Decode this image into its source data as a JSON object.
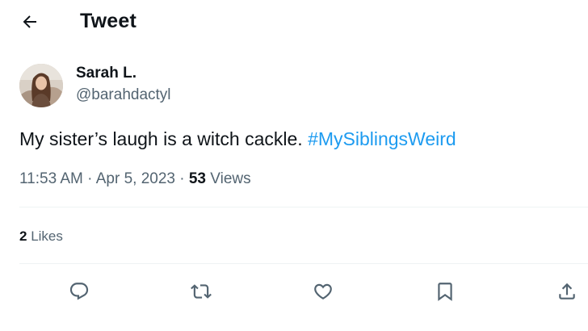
{
  "header": {
    "title": "Tweet",
    "back_icon": "arrow-left-icon"
  },
  "tweet": {
    "author": {
      "display_name": "Sarah L.",
      "handle": "@barahdactyl",
      "avatar_icon": "user-avatar"
    },
    "text_plain": "My sister’s laugh is a witch cackle. ",
    "hashtag": "#MySiblingsWeird",
    "time": "11:53 AM",
    "separator": " · ",
    "date": "Apr 5, 2023",
    "views_count": "53",
    "views_label": " Views",
    "likes_count": "2",
    "likes_label": " Likes"
  },
  "actions": [
    {
      "name": "reply",
      "icon": "reply-icon"
    },
    {
      "name": "retweet",
      "icon": "retweet-icon"
    },
    {
      "name": "like",
      "icon": "heart-icon"
    },
    {
      "name": "bookmark",
      "icon": "bookmark-icon"
    },
    {
      "name": "share",
      "icon": "share-icon"
    }
  ],
  "colors": {
    "text": "#0f1419",
    "secondary": "#536471",
    "link": "#1d9bf0",
    "divider": "#eff3f4"
  }
}
